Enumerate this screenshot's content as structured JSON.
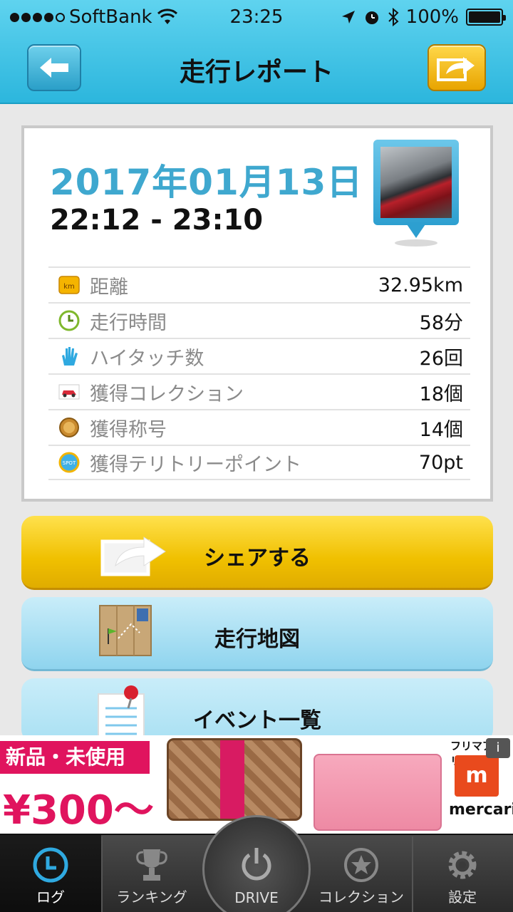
{
  "status_bar": {
    "carrier": "SoftBank",
    "time": "23:25",
    "battery": "100%"
  },
  "nav": {
    "title": "走行レポート"
  },
  "report": {
    "date": "2017年01月13日",
    "time_range": "22:12 - 23:10",
    "stats": [
      {
        "icon": "km-icon",
        "label": "距離",
        "value": "32.95km"
      },
      {
        "icon": "clock-icon",
        "label": "走行時間",
        "value": "58分"
      },
      {
        "icon": "hand-icon",
        "label": "ハイタッチ数",
        "value": "26回"
      },
      {
        "icon": "car-icon",
        "label": "獲得コレクション",
        "value": "18個"
      },
      {
        "icon": "medal-icon",
        "label": "獲得称号",
        "value": "14個"
      },
      {
        "icon": "spot-icon",
        "label": "獲得テリトリーポイント",
        "value": "70pt"
      }
    ],
    "km_badge": "km",
    "spot_badge": "SPOT"
  },
  "actions": {
    "share": "シェアする",
    "map": "走行地図",
    "events": "イベント一覧"
  },
  "ad": {
    "tag": "新品・未使用",
    "price": "¥300〜",
    "brand_top": "フリマアプリ",
    "brand_mark": "m",
    "brand_name": "mercari",
    "info": "i"
  },
  "tabs": {
    "log": "ログ",
    "ranking": "ランキング",
    "drive": "DRIVE",
    "collection": "コレクション",
    "settings": "設定"
  },
  "colors": {
    "accent_blue": "#3fa8cf",
    "share_yellow": "#f0c000",
    "ad_pink": "#e0145e"
  }
}
